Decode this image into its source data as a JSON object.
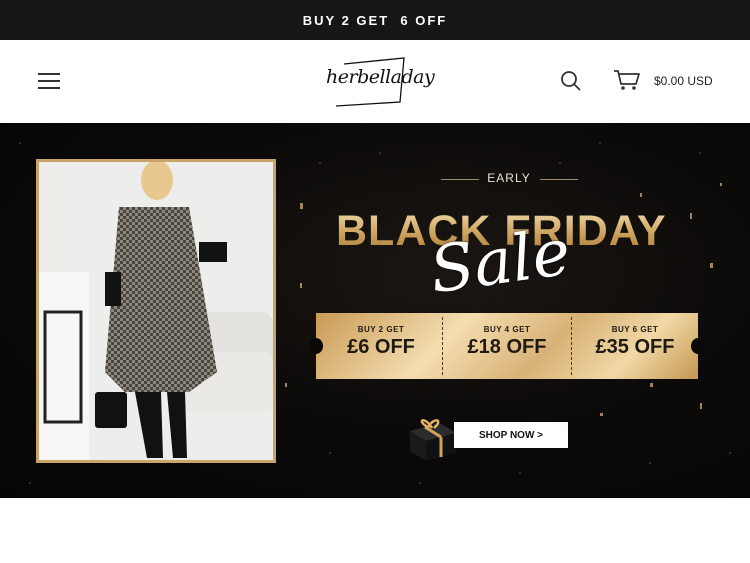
{
  "announcement": {
    "text": "BUY 2 GET  6 OFF"
  },
  "header": {
    "logo_text": "herbelladay",
    "cart_amount": "$0.00 USD"
  },
  "banner": {
    "early": "EARLY",
    "title": "BLACK FRIDAY",
    "script": "Sale",
    "coupons": [
      {
        "small": "BUY 2 GET",
        "big": "£6 OFF"
      },
      {
        "small": "BUY 4 GET",
        "big": "£18 OFF"
      },
      {
        "small": "BUY 6 GET",
        "big": "£35 OFF"
      }
    ],
    "cta": "SHOP NOW >"
  },
  "colors": {
    "gold": "#c9a46a",
    "dark": "#161616"
  }
}
